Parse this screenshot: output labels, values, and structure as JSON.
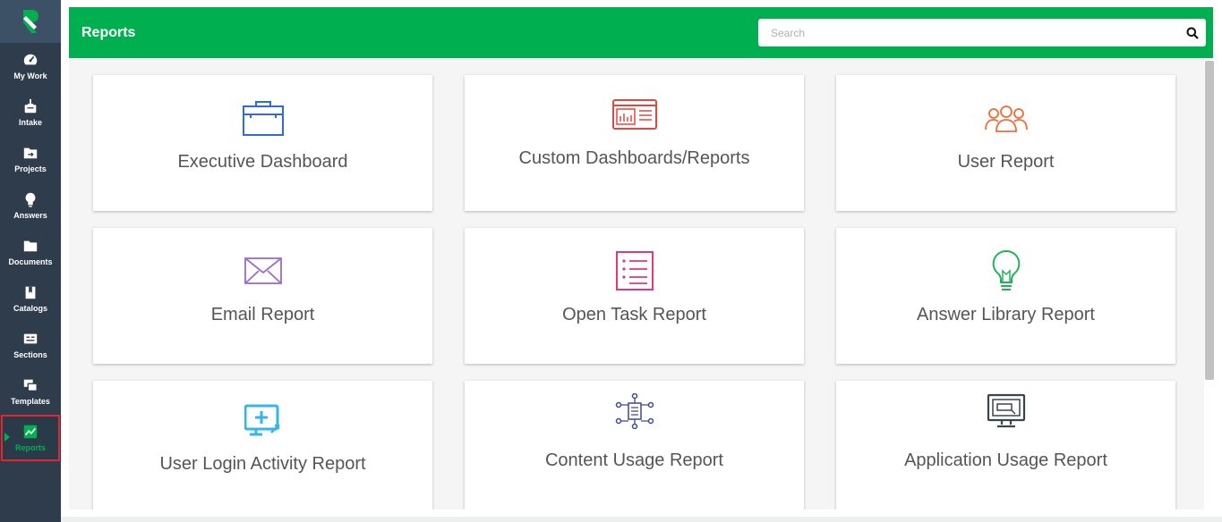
{
  "nav": {
    "items": [
      {
        "label": "My Work",
        "icon": "dashboard-gauge-icon"
      },
      {
        "label": "Intake",
        "icon": "intake-tray-icon"
      },
      {
        "label": "Projects",
        "icon": "folder-arrow-icon"
      },
      {
        "label": "Answers",
        "icon": "lightbulb-icon"
      },
      {
        "label": "Documents",
        "icon": "documents-folder-icon"
      },
      {
        "label": "Catalogs",
        "icon": "book-icon"
      },
      {
        "label": "Sections",
        "icon": "sections-list-icon"
      },
      {
        "label": "Templates",
        "icon": "templates-copy-icon"
      },
      {
        "label": "Reports",
        "icon": "chart-line-icon",
        "active": true
      }
    ]
  },
  "header": {
    "title": "Reports",
    "search_placeholder": "Search"
  },
  "cards": [
    {
      "label": "Executive Dashboard",
      "icon": "briefcase-icon",
      "color": "#2f6bd6"
    },
    {
      "label": "Custom Dashboards/Reports",
      "icon": "report-panel-icon",
      "color": "#e0483e"
    },
    {
      "label": "User Report",
      "icon": "users-group-icon",
      "color": "#f06a36"
    },
    {
      "label": "Email Report",
      "icon": "envelope-icon",
      "color": "#9b6bc9"
    },
    {
      "label": "Open Task Report",
      "icon": "task-list-icon",
      "color": "#e0397a"
    },
    {
      "label": "Answer Library Report",
      "icon": "lightbulb-outline-icon",
      "color": "#22b35a"
    },
    {
      "label": "User Login Activity Report",
      "icon": "monitor-plus-icon",
      "color": "#35b6ea"
    },
    {
      "label": "Content Usage Report",
      "icon": "network-document-icon",
      "color": "#3d4a8a"
    },
    {
      "label": "Application Usage Report",
      "icon": "computer-screen-icon",
      "color": "#39444f"
    }
  ],
  "colors": {
    "brand": "#00b050",
    "sidebar": "#2f3c4b",
    "active_outline": "#e0262e"
  }
}
